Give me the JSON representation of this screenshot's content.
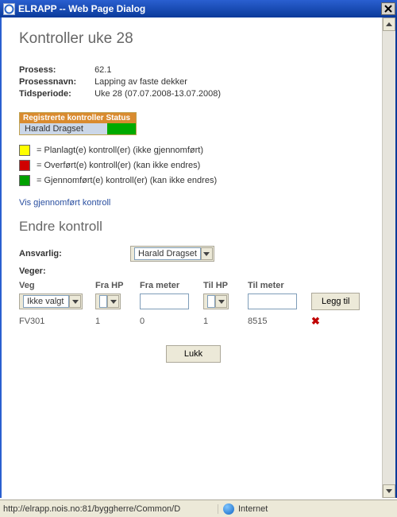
{
  "window": {
    "title": "ELRAPP -- Web Page Dialog"
  },
  "page": {
    "heading": "Kontroller uke 28",
    "info": {
      "prosess_label": "Prosess:",
      "prosess_value": "62.1",
      "prosessnavn_label": "Prosessnavn:",
      "prosessnavn_value": "Lapping av faste dekker",
      "tidsperiode_label": "Tidsperiode:",
      "tidsperiode_value": "Uke 28 (07.07.2008-13.07.2008)"
    },
    "status": {
      "header": "Registrerte kontroller Status",
      "name": "Harald Dragset"
    },
    "legend": {
      "yellow": "= Planlagt(e) kontroll(er) (ikke gjennomført)",
      "red": "= Overført(e) kontroll(er) (kan ikke endres)",
      "green": "= Gjennomført(e) kontroll(er) (kan ikke endres)"
    },
    "link_completed": "Vis gjennomført kontroll",
    "edit_heading": "Endre kontroll",
    "form": {
      "ansvarlig_label": "Ansvarlig:",
      "ansvarlig_value": "Harald Dragset",
      "veger_label": "Veger:",
      "cols": {
        "veg": "Veg",
        "frahp": "Fra HP",
        "frameter": "Fra meter",
        "tilhp": "Til HP",
        "tilmeter": "Til meter"
      },
      "veg_select": "Ikke valgt",
      "add_button": "Legg til",
      "row": {
        "veg": "FV301",
        "frahp": "1",
        "frameter": "0",
        "tilhp": "1",
        "tilmeter": "8515"
      },
      "close_button": "Lukk"
    }
  },
  "statusbar": {
    "url": "http://elrapp.nois.no:81/byggherre/Common/D",
    "zone": "Internet"
  }
}
